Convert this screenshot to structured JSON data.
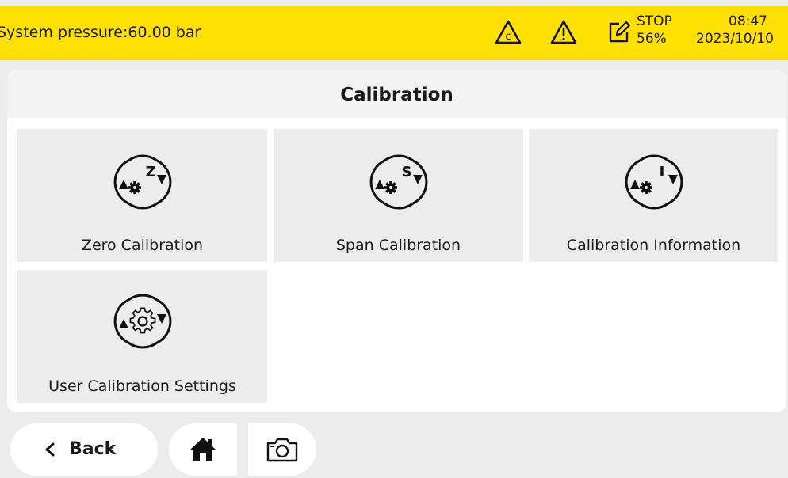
{
  "status_bar": {
    "pressure": "System pressure:60.00 bar",
    "calibration_alarm_icon": "calibration-warning-icon",
    "warning_icon": "warning-icon",
    "edit_icon": "edit-icon",
    "run_state": "STOP",
    "run_progress": "56%",
    "time": "08:47",
    "date": "2023/10/10",
    "background_color": "#ffe000"
  },
  "page": {
    "title": "Calibration"
  },
  "tiles": [
    {
      "label": "Zero Calibration",
      "icon": "zero-calibration-icon",
      "glyph": "Z"
    },
    {
      "label": "Span Calibration",
      "icon": "span-calibration-icon",
      "glyph": "S"
    },
    {
      "label": "Calibration Information",
      "icon": "calibration-information-icon",
      "glyph": "I"
    },
    {
      "label": "User Calibration Settings",
      "icon": "user-calibration-settings-icon",
      "glyph": ""
    }
  ],
  "nav": {
    "back_label": "Back",
    "home_icon": "home-icon",
    "camera_icon": "camera-icon"
  }
}
